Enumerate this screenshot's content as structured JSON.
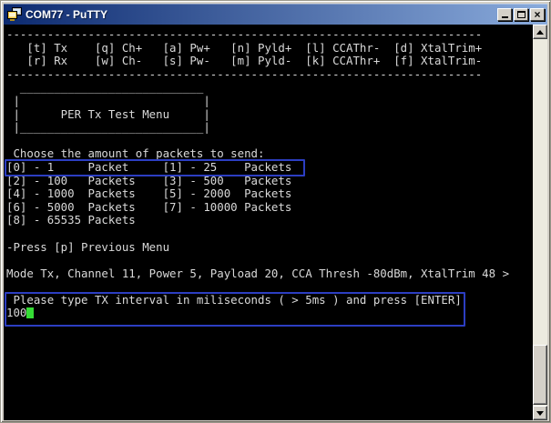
{
  "window": {
    "title": "COM77 - PuTTY",
    "close_glyph": "×",
    "icons": [
      "putty-icon",
      "minimize-icon",
      "maximize-icon",
      "close-icon",
      "scroll-up-icon",
      "scroll-down-icon"
    ]
  },
  "colors": {
    "titlebar-left": "#0c2a70",
    "titlebar-right": "#8aabdc",
    "terminal-bg": "#000000",
    "terminal-fg": "#d9d9d9",
    "highlight": "#2c3ec2",
    "cursor": "#35dd35",
    "chrome": "#d4d0c8"
  },
  "terminal": {
    "lines": [
      "----------------------------------------------------------------------",
      "   [t] Tx    [q] Ch+   [a] Pw+   [n] Pyld+  [l] CCAThr-  [d] XtalTrim+",
      "   [r] Rx    [w] Ch-   [s] Pw-   [m] Pyld-  [k] CCAThr+  [f] XtalTrim-",
      "----------------------------------------------------------------------",
      "  ___________________________",
      " |                           |",
      " |      PER Tx Test Menu     |",
      " |___________________________|",
      "",
      " Choose the amount of packets to send:",
      "[0] - 1     Packet     [1] - 25    Packets",
      "[2] - 100   Packets    [3] - 500   Packets",
      "[4] - 1000  Packets    [5] - 2000  Packets",
      "[6] - 5000  Packets    [7] - 10000 Packets",
      "[8] - 65535 Packets",
      "",
      "-Press [p] Previous Menu",
      "",
      "Mode Tx, Channel 11, Power 5, Payload 20, CCA Thresh -80dBm, XtalTrim 48 >",
      "",
      " Please type TX interval in miliseconds ( > 5ms ) and press [ENTER]"
    ],
    "input_value": "100",
    "status_summary": "Mode Tx, Channel 11, Power 5, Payload 20, CCA Thresh -80dBm, XtalTrim 48",
    "highlighted": {
      "packets_option": "[0] - 1     Packet     [1] - 25    Packets",
      "interval_prompt": "Please type TX interval in miliseconds ( > 5ms ) and press [ENTER]"
    }
  }
}
